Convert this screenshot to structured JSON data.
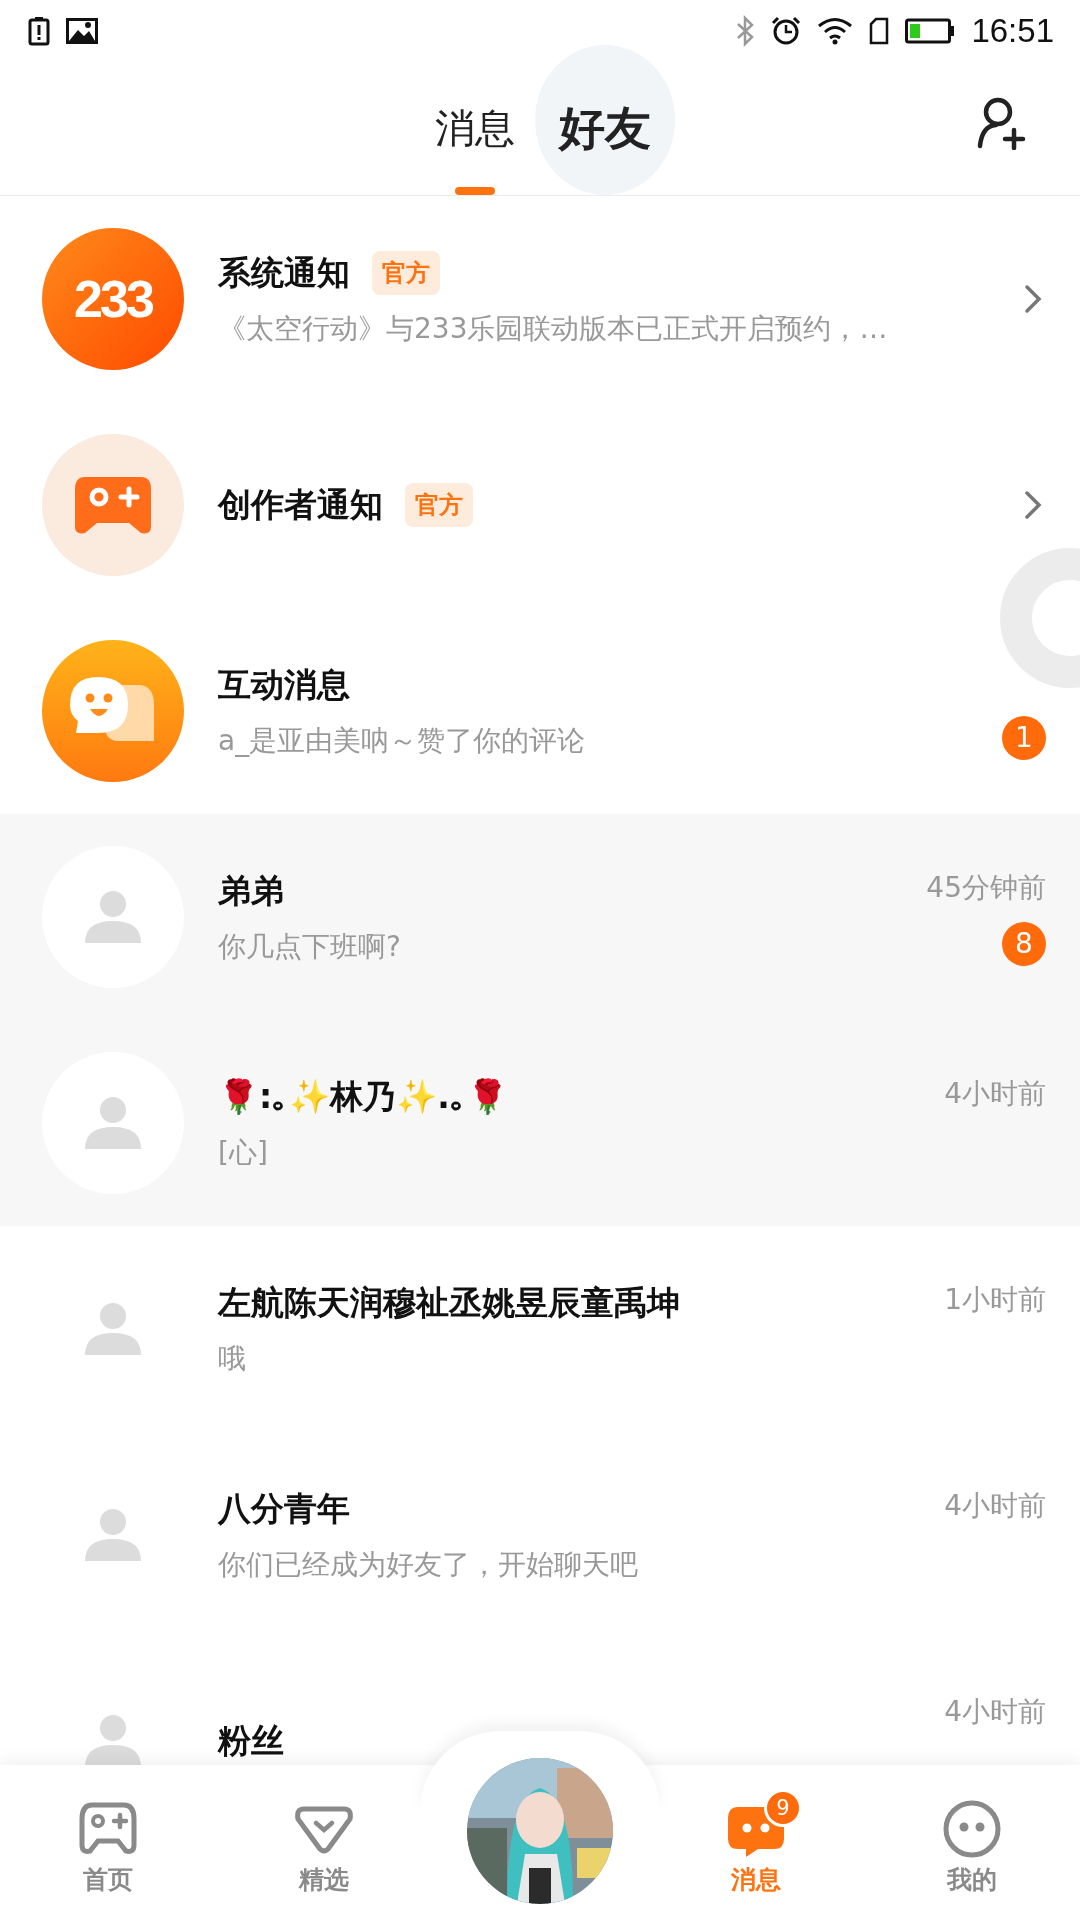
{
  "status_bar": {
    "time": "16:51"
  },
  "tabs": [
    {
      "label": "消息",
      "selected": true,
      "pressed": false
    },
    {
      "label": "好友",
      "selected": false,
      "pressed": true
    }
  ],
  "conversations": [
    {
      "kind": "system",
      "avatar_text": "233",
      "name": "系统通知",
      "tag": "官方",
      "preview": "《太空行动》与233乐园联动版本已正式开启预约，…",
      "chevron": true,
      "highlighted": false
    },
    {
      "kind": "creator",
      "name": "创作者通知",
      "tag": "官方",
      "chevron": true,
      "highlighted": false
    },
    {
      "kind": "interaction",
      "name": "互动消息",
      "preview": "a_是亚由美呐～赞了你的评论",
      "badge": "1",
      "chevron": false,
      "highlighted": false
    },
    {
      "kind": "friend",
      "name": "弟弟",
      "preview": "你几点下班啊?",
      "time": "45分钟前",
      "badge": "8",
      "chevron": false,
      "highlighted": true
    },
    {
      "kind": "friend",
      "name": "🌹:｡✨林乃✨.｡🌹",
      "preview": "[心]",
      "time": "4小时前",
      "chevron": false,
      "highlighted": true
    },
    {
      "kind": "friend",
      "name": "左航陈天润穆祉丞姚昱辰童禹坤",
      "preview": "哦",
      "time": "1小时前",
      "chevron": false,
      "highlighted": false
    },
    {
      "kind": "friend",
      "name": "八分青年",
      "preview": "你们已经成为好友了，开始聊天吧",
      "time": "4小时前",
      "chevron": false,
      "highlighted": false
    },
    {
      "kind": "friend",
      "name": "粉丝",
      "time": "4小时前",
      "chevron": false,
      "highlighted": false
    }
  ],
  "bottom_nav": [
    {
      "kind": "gamepad",
      "label": "首页",
      "selected": false
    },
    {
      "kind": "heart",
      "label": "精选",
      "selected": false
    },
    {
      "kind": "avatar"
    },
    {
      "kind": "chat",
      "label": "消息",
      "selected": true,
      "badge": "9"
    },
    {
      "kind": "face",
      "label": "我的",
      "selected": false
    }
  ]
}
